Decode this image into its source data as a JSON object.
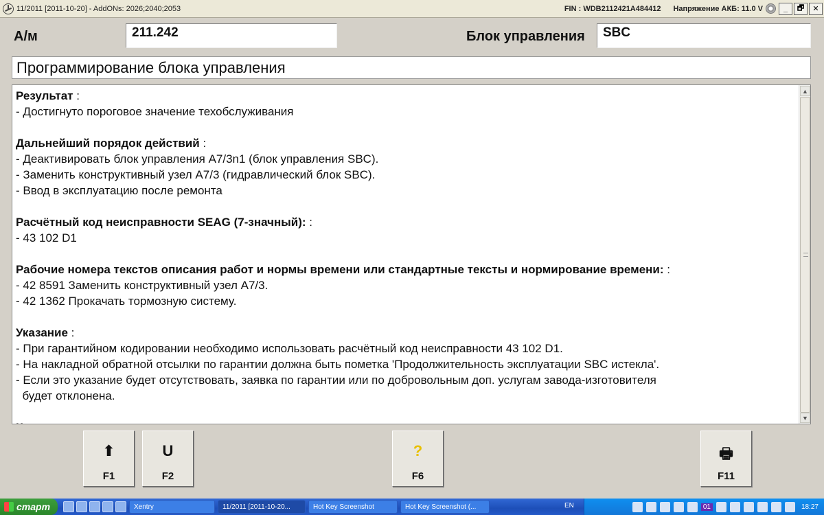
{
  "window": {
    "title": "11/2011 [2011-10-20] - AddONs: 2026;2040;2053",
    "fin": "FIN : WDB2112421A484412",
    "voltage": "Напряжение АКБ: 11.0 V",
    "min_label": "_",
    "restore_label": "🗗",
    "close_label": "✕"
  },
  "header": {
    "car_label": "А/м",
    "car_value": "211.242",
    "unit_label": "Блок управления",
    "unit_value": "SBC"
  },
  "banner": "Программирование блока управления",
  "content": {
    "sections": [
      {
        "head": "Результат",
        "colon": " :",
        "lines": [
          "- Достигнуто пороговое значение техобслуживания"
        ]
      },
      {
        "head": "Дальнейший порядок действий",
        "colon": " :",
        "lines": [
          "- Деактивировать блок управления A7/3n1 (блок управления SBC).",
          "- Заменить конструктивный узел A7/3 (гидравлический блок SBC).",
          "- Ввод в эксплуатацию после ремонта"
        ]
      },
      {
        "head": "Расчётный код неисправности SEAG (7-значный):",
        "colon": " :",
        "lines": [
          "- 43 102 D1"
        ]
      },
      {
        "head": "Рабочие номера текстов описания работ и нормы времени или стандартные тексты и нормирование времени:",
        "colon": " :",
        "lines": [
          "- 42 8591 Заменить конструктивный узел A7/3.",
          "- 42 1362 Прокачать тормозную систему."
        ]
      },
      {
        "head": "Указание",
        "colon": " :",
        "lines": [
          "- При гарантийном кодировании необходимо использовать расчётный код неисправности 43 102 D1.",
          "- На накладной обратной отсылки по гарантии должна быть пометка 'Продолжительность эксплуатации SBC истекла'.",
          "- Если это указание будет отсутствовать, заявка по гарантии или по добровольным доп. услугам завода-изготовителя",
          "  будет отклонена."
        ]
      },
      {
        "head": "Конец проверки",
        "colon": "",
        "lines": []
      }
    ]
  },
  "fkeys": [
    {
      "icon": "⬆",
      "label": "F1"
    },
    {
      "icon": "U",
      "label": "F2"
    },
    {
      "icon": "?",
      "label": "F6"
    },
    {
      "icon": "🖶",
      "label": "F11"
    }
  ],
  "taskbar": {
    "start_label": "старт",
    "tasks": [
      {
        "label": "Xentry"
      },
      {
        "label": "11/2011 [2011-10-20..."
      },
      {
        "label": "Hot Key Screenshot"
      },
      {
        "label": "Hot Key Screenshot (..."
      }
    ],
    "lang": "EN",
    "badge": "01",
    "clock": "18:27"
  }
}
